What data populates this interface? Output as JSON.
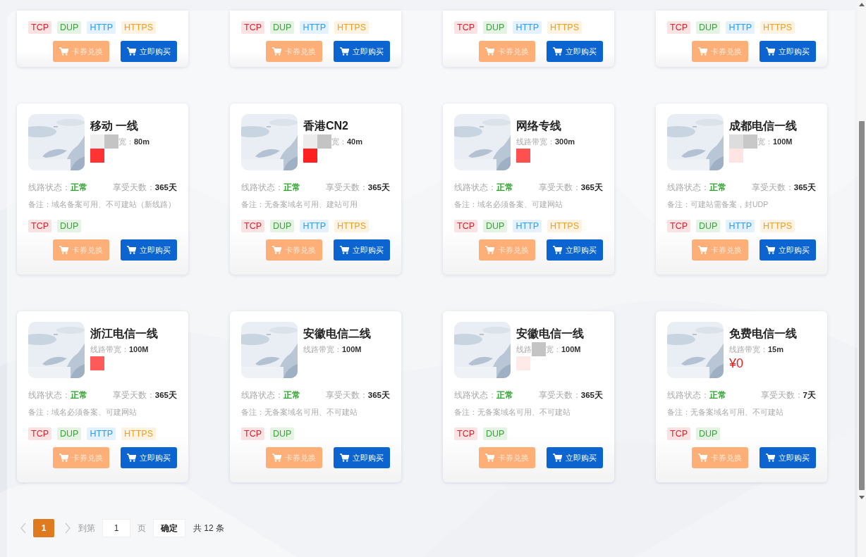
{
  "cut_cards": [
    {
      "tags": [
        {
          "text": "TCP",
          "color": "#e0202a"
        },
        {
          "text": "DUP",
          "color": "#3aa03a"
        },
        {
          "text": "HTTP",
          "color": "#2a9df4"
        },
        {
          "text": "HTTPS",
          "color": "#f0a020"
        }
      ],
      "redeem": "卡券兑换",
      "buy": "立即购买"
    },
    {
      "tags": [
        {
          "text": "TCP",
          "color": "#e0202a"
        },
        {
          "text": "DUP",
          "color": "#3aa03a"
        },
        {
          "text": "HTTP",
          "color": "#2a9df4"
        },
        {
          "text": "HTTPS",
          "color": "#f0a020"
        }
      ],
      "redeem": "卡券兑换",
      "buy": "立即购买"
    },
    {
      "tags": [
        {
          "text": "TCP",
          "color": "#e0202a"
        },
        {
          "text": "DUP",
          "color": "#3aa03a"
        },
        {
          "text": "HTTP",
          "color": "#2a9df4"
        },
        {
          "text": "HTTPS",
          "color": "#f0a020"
        }
      ],
      "redeem": "卡券兑换",
      "buy": "立即购买"
    },
    {
      "tags": [
        {
          "text": "TCP",
          "color": "#e0202a"
        },
        {
          "text": "DUP",
          "color": "#3aa03a"
        },
        {
          "text": "HTTP",
          "color": "#2a9df4"
        },
        {
          "text": "HTTPS",
          "color": "#f0a020"
        }
      ],
      "redeem": "卡券兑换",
      "buy": "立即购买"
    }
  ],
  "cards": [
    {
      "title": "移动 一线",
      "bandwidth_line": [
        {
          "kind": "mosaic",
          "color": "#eeeeee"
        },
        {
          "kind": "mosaic",
          "color": "#c4c4c4"
        },
        {
          "kind": "text",
          "text": "宽："
        }
      ],
      "bandwidth": "80m",
      "price_line": [
        {
          "kind": "mosaic",
          "color": "#ff3333"
        }
      ],
      "status_label": "线路状态：",
      "status": "正常",
      "days_label": "享受天数：",
      "days": "365天",
      "note": "备注：域名备案可用、不可建站（新线路）",
      "tags": [
        {
          "text": "TCP",
          "color": "#e0202a"
        },
        {
          "text": "DUP",
          "color": "#3aa03a"
        }
      ],
      "redeem": "卡券兑换",
      "buy": "立即购买"
    },
    {
      "title": "香港CN2",
      "bandwidth_line": [
        {
          "kind": "mosaic",
          "color": "#ececec"
        },
        {
          "kind": "mosaic",
          "color": "#c4c4c4"
        },
        {
          "kind": "text",
          "text": "宽："
        }
      ],
      "bandwidth": "40m",
      "price_line": [
        {
          "kind": "mosaic",
          "color": "#ff2020"
        }
      ],
      "status_label": "线路状态：",
      "status": "正常",
      "days_label": "享受天数：",
      "days": "365天",
      "note": "备注：无备案域名可用、建站可用",
      "tags": [
        {
          "text": "TCP",
          "color": "#e0202a"
        },
        {
          "text": "DUP",
          "color": "#3aa03a"
        },
        {
          "text": "HTTP",
          "color": "#2a9df4"
        },
        {
          "text": "HTTPS",
          "color": "#f0a020"
        }
      ],
      "redeem": "卡券兑换",
      "buy": "立即购买"
    },
    {
      "title": "网络专线",
      "bandwidth_line": [
        {
          "kind": "text",
          "text": "线路带宽："
        }
      ],
      "bandwidth": "300m",
      "price_line": [
        {
          "kind": "mosaic",
          "color": "#ff5050"
        }
      ],
      "status_label": "线路状态：",
      "status": "正常",
      "days_label": "享受天数：",
      "days": "365天",
      "note": "备注：域名必须备案、可建网站",
      "tags": [
        {
          "text": "TCP",
          "color": "#e0202a"
        },
        {
          "text": "DUP",
          "color": "#3aa03a"
        },
        {
          "text": "HTTP",
          "color": "#2a9df4"
        },
        {
          "text": "HTTPS",
          "color": "#f0a020"
        }
      ],
      "redeem": "卡券兑换",
      "buy": "立即购买"
    },
    {
      "title": "成都电信一线",
      "bandwidth_line": [
        {
          "kind": "mosaic",
          "color": "#dddddd"
        },
        {
          "kind": "mosaic",
          "color": "#c8c8c8"
        },
        {
          "kind": "text",
          "text": "宽："
        }
      ],
      "bandwidth": "100M",
      "price_line": [
        {
          "kind": "mosaic",
          "color": "#ffe4e4"
        }
      ],
      "status_label": "线路状态：",
      "status": "正常",
      "days_label": "享受天数：",
      "days": "365天",
      "note": "备注：可建站需备案，封UDP",
      "tags": [
        {
          "text": "TCP",
          "color": "#e0202a"
        },
        {
          "text": "DUP",
          "color": "#3aa03a"
        },
        {
          "text": "HTTP",
          "color": "#2a9df4"
        },
        {
          "text": "HTTPS",
          "color": "#f0a020"
        }
      ],
      "redeem": "卡券兑换",
      "buy": "立即购买"
    },
    {
      "title": "浙江电信一线",
      "bandwidth_line": [
        {
          "kind": "text",
          "text": "线路带宽："
        }
      ],
      "bandwidth": "100M",
      "price_line": [
        {
          "kind": "mosaic",
          "color": "#ff5a5a"
        }
      ],
      "status_label": "线路状态：",
      "status": "正常",
      "days_label": "享受天数：",
      "days": "365天",
      "note": "备注：域名必须备案、可建网站",
      "tags": [
        {
          "text": "TCP",
          "color": "#e0202a"
        },
        {
          "text": "DUP",
          "color": "#3aa03a"
        },
        {
          "text": "HTTP",
          "color": "#2a9df4"
        },
        {
          "text": "HTTPS",
          "color": "#f0a020"
        }
      ],
      "redeem": "卡券兑换",
      "buy": "立即购买"
    },
    {
      "title": "安徽电信二线",
      "bandwidth_line": [
        {
          "kind": "text",
          "text": "线路带宽："
        }
      ],
      "bandwidth": "100M",
      "status_label": "线路状态：",
      "status": "正常",
      "days_label": "享受天数：",
      "days": "365天",
      "note": "备注：无备案域名可用、不可建站",
      "tags": [
        {
          "text": "TCP",
          "color": "#e0202a"
        },
        {
          "text": "DUP",
          "color": "#3aa03a"
        }
      ],
      "redeem": "卡券兑换",
      "buy": "立即购买"
    },
    {
      "title": "安徽电信一线",
      "bandwidth_line": [
        {
          "kind": "text",
          "text": "线路"
        },
        {
          "kind": "mosaic",
          "color": "#c4c4c4"
        },
        {
          "kind": "text",
          "text": "宽："
        }
      ],
      "bandwidth": "100M",
      "price_line": [
        {
          "kind": "mosaic",
          "color": "#ffeaea"
        }
      ],
      "status_label": "线路状态：",
      "status": "正常",
      "days_label": "享受天数：",
      "days": "365天",
      "note": "备注：无备案域名可用、不可建站",
      "tags": [
        {
          "text": "TCP",
          "color": "#e0202a"
        },
        {
          "text": "DUP",
          "color": "#3aa03a"
        }
      ],
      "redeem": "卡券兑换",
      "buy": "立即购买"
    },
    {
      "title": "免费电信一线",
      "bandwidth_line": [
        {
          "kind": "text",
          "text": "线路带宽："
        }
      ],
      "bandwidth": "15m",
      "price_line": [
        {
          "kind": "price",
          "text": "¥0"
        }
      ],
      "status_label": "线路状态：",
      "status": "正常",
      "days_label": "享受天数：",
      "days": "7天",
      "note": "备注：无备案域名可用、不可建站",
      "tags": [
        {
          "text": "TCP",
          "color": "#e0202a"
        },
        {
          "text": "DUP",
          "color": "#3aa03a"
        }
      ],
      "redeem": "卡券兑换",
      "buy": "立即购买"
    }
  ],
  "pagination": {
    "pages": [
      {
        "text": "1",
        "selected": true
      }
    ],
    "goto_label": "到第",
    "page_input": "1",
    "page_unit": "页",
    "confirm": "确定",
    "total": "共 12 条"
  }
}
